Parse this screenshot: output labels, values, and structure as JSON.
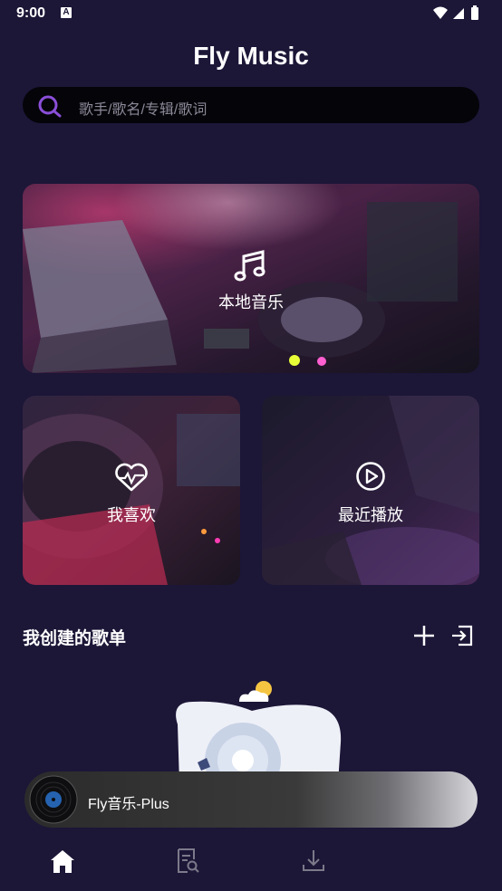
{
  "status_bar": {
    "time": "9:00",
    "notification_icon": "a-letter-icon",
    "icons": [
      "wifi-icon",
      "signal-icon",
      "battery-icon"
    ]
  },
  "app": {
    "title": "Fly Music"
  },
  "search": {
    "placeholder": "歌手/歌名/专辑/歌词",
    "icon": "search-icon",
    "accent": "#8a4fd8"
  },
  "cards": {
    "local_music": {
      "label": "本地音乐",
      "icon": "music-note-icon"
    },
    "favorites": {
      "label": "我喜欢",
      "icon": "heart-pulse-icon"
    },
    "recent": {
      "label": "最近播放",
      "icon": "play-circle-icon"
    }
  },
  "playlists": {
    "title": "我创建的歌单",
    "add_icon": "plus-icon",
    "import_icon": "import-icon"
  },
  "player": {
    "title": "Fly音乐-Plus",
    "icon": "vinyl-disc-icon"
  },
  "tabs": [
    {
      "name": "home",
      "icon": "home-icon",
      "active": true
    },
    {
      "name": "search-list",
      "icon": "document-search-icon",
      "active": false
    },
    {
      "name": "download",
      "icon": "download-icon",
      "active": false
    }
  ]
}
